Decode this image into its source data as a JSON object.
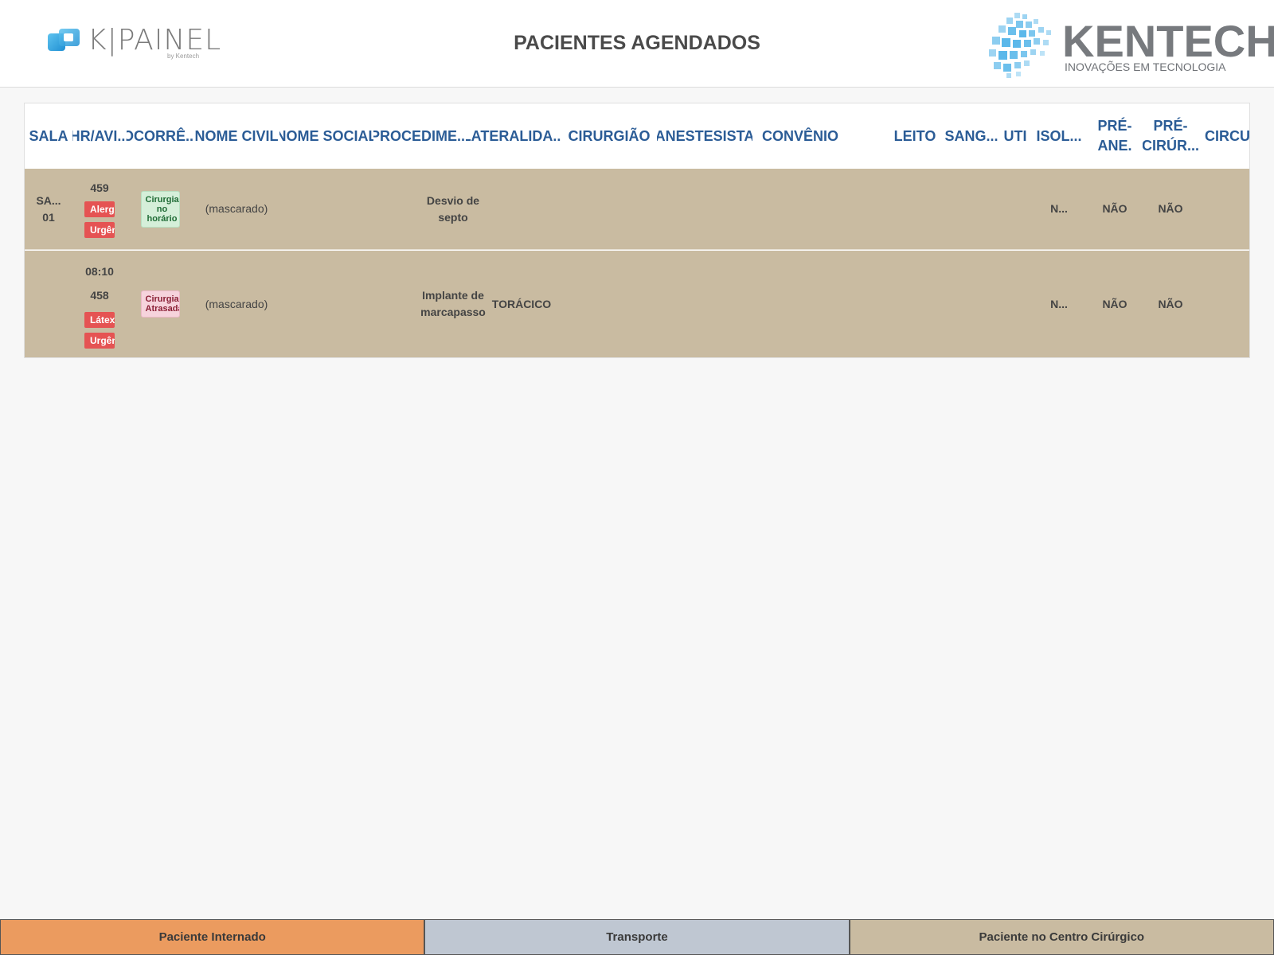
{
  "header": {
    "logo_left_text": "K|PAINEL",
    "logo_left_by": "by Kentech",
    "title": "PACIENTES AGENDADOS",
    "logo_right_name": "KENTECH",
    "logo_right_tagline": "INOVAÇÕES EM TECNOLOGIA"
  },
  "table": {
    "columns": [
      "SALA",
      "HR/AVI...",
      "OCORRÊ...",
      "NOME CIVIL",
      "NOME SOCIAL",
      "PROCEDIME...",
      "LATERALIDA...",
      "CIRURGIÃO",
      "ANESTESISTA",
      "CONVÊNIO",
      "LEITO",
      "SANG...",
      "UTI",
      "ISOL...",
      "PRÉ-ANE.",
      "PRÉ-CIRÚR...",
      "CIRCU"
    ],
    "rows": [
      {
        "sala": [
          "SA...",
          "01"
        ],
        "hora": "",
        "aviso": "459",
        "badges": [
          "Alergia",
          "Urgência"
        ],
        "ocorrencia": "Cirurgia no horário",
        "nome_civil": "(mascarado)",
        "nome_social": "",
        "procedimento": "Desvio de septo",
        "lateralidade": "",
        "isolamento": "N...",
        "pre_anestesico": "NÃO",
        "pre_cirurgico": "NÃO"
      },
      {
        "sala": [
          "",
          ""
        ],
        "hora": "08:10",
        "aviso": "458",
        "badges": [
          "Látex",
          "Urgência"
        ],
        "ocorrencia": "Cirurgia Atrasada",
        "nome_civil": "(mascarado)",
        "nome_social": "",
        "procedimento": "Implante de marcapasso",
        "lateralidade": "TORÁCICO",
        "isolamento": "N...",
        "pre_anestesico": "NÃO",
        "pre_cirurgico": "NÃO"
      }
    ]
  },
  "legend": [
    {
      "label": "Paciente Internado",
      "color": "#eb9b5f"
    },
    {
      "label": "Transporte",
      "color": "#bfc7d2"
    },
    {
      "label": "Paciente no Centro Cirúrgico",
      "color": "#c9bba1"
    }
  ],
  "colors": {
    "header_text": "#2b5c96",
    "row_background": "#c9bba1",
    "badge_red": "#e55353"
  }
}
